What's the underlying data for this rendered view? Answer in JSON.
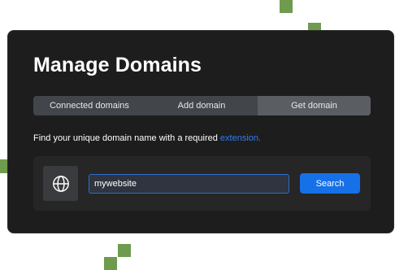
{
  "page": {
    "title": "Manage Domains",
    "tabs": [
      {
        "label": "Connected domains",
        "active": false
      },
      {
        "label": "Add domain",
        "active": false
      },
      {
        "label": "Get domain",
        "active": true
      }
    ],
    "description": {
      "text": "Find your unique domain name with a required ",
      "link": "extension."
    },
    "search": {
      "icon": "globe-icon",
      "value": "mywebsite",
      "button_label": "Search"
    }
  },
  "colors": {
    "card_bg": "#1d1d1d",
    "accent_blue": "#1670e8",
    "link_blue": "#2e7df1",
    "decor_green": "#6e9b4e"
  }
}
